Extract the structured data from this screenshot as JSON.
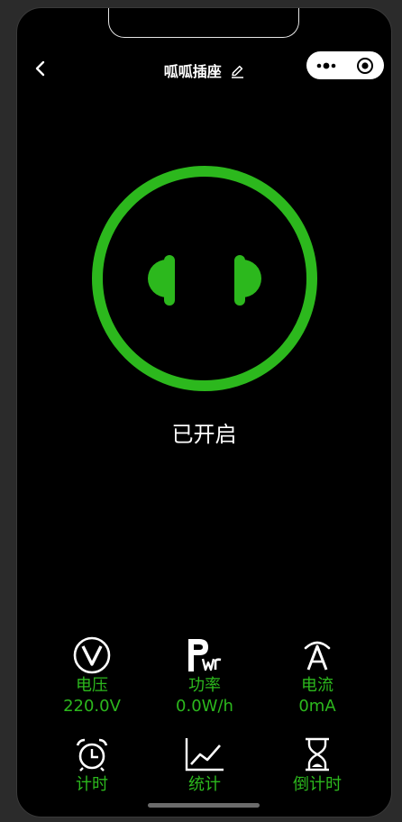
{
  "nav": {
    "title": "呱呱插座"
  },
  "device": {
    "status": "已开启",
    "power_on": true,
    "accent_color": "#2cb81d"
  },
  "metrics": [
    {
      "icon": "voltage-icon",
      "label": "电压",
      "value": "220.0V"
    },
    {
      "icon": "power-icon",
      "label": "功率",
      "value": "0.0W/h"
    },
    {
      "icon": "current-icon",
      "label": "电流",
      "value": "0mA"
    }
  ],
  "actions": [
    {
      "icon": "alarm-clock-icon",
      "label": "计时"
    },
    {
      "icon": "line-chart-icon",
      "label": "统计"
    },
    {
      "icon": "hourglass-icon",
      "label": "倒计时"
    }
  ]
}
